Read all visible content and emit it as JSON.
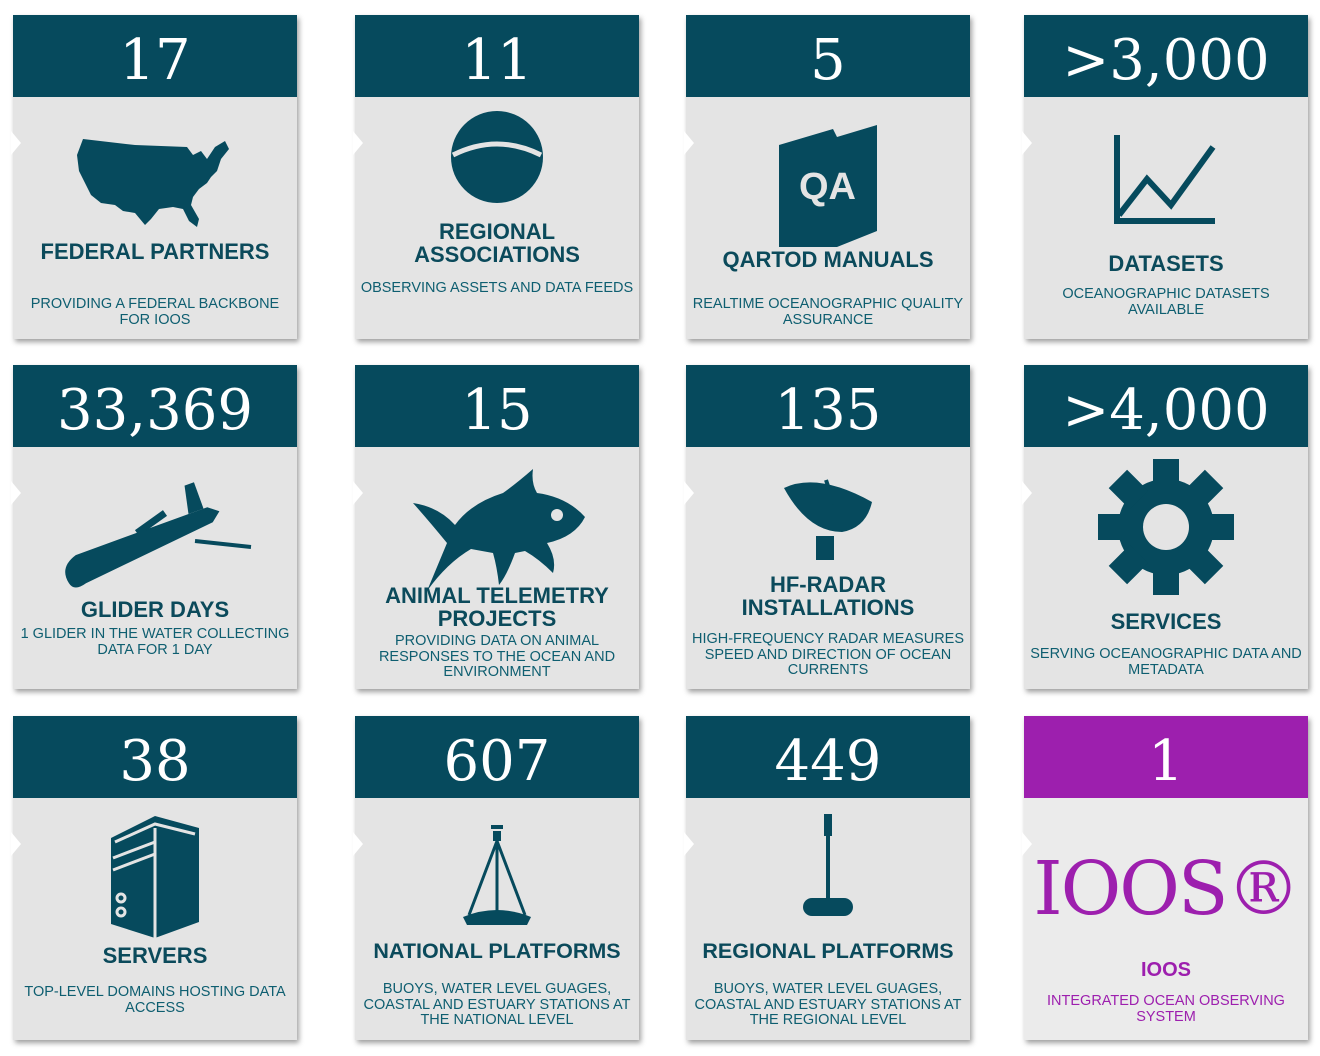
{
  "cards": [
    {
      "number": "17",
      "title": "FEDERAL PARTNERS",
      "description": "PROVIDING A FEDERAL BACKBONE FOR IOOS",
      "icon": "usa-map-icon"
    },
    {
      "number": "11",
      "title": "REGIONAL ASSOCIATIONS",
      "description": "OBSERVING ASSETS AND DATA FEEDS",
      "icon": "sphere-icon"
    },
    {
      "number": "5",
      "title": "QARTOD MANUALS",
      "description": "REALTIME OCEANOGRAPHIC QUALITY ASSURANCE",
      "icon": "qa-manual-icon",
      "icon_text": "QA"
    },
    {
      "number": ">3,000",
      "title": "DATASETS",
      "description": "OCEANOGRAPHIC DATASETS AVAILABLE",
      "icon": "line-chart-icon"
    },
    {
      "number": "33,369",
      "title": "GLIDER DAYS",
      "description": "1 GLIDER IN THE WATER COLLECTING DATA FOR 1 DAY",
      "icon": "glider-icon"
    },
    {
      "number": "15",
      "title": "ANIMAL TELEMETRY PROJECTS",
      "description": "PROVIDING DATA ON ANIMAL RESPONSES TO THE OCEAN AND ENVIRONMENT",
      "icon": "fish-icon"
    },
    {
      "number": "135",
      "title": "HF-RADAR INSTALLATIONS",
      "description": "HIGH-FREQUENCY RADAR MEASURES SPEED AND DIRECTION OF OCEAN CURRENTS",
      "icon": "radar-dish-icon"
    },
    {
      "number": ">4,000",
      "title": "SERVICES",
      "description": "SERVING OCEANOGRAPHIC DATA AND METADATA",
      "icon": "gear-icon"
    },
    {
      "number": "38",
      "title": "SERVERS",
      "description": "TOP-LEVEL DOMAINS HOSTING DATA ACCESS",
      "icon": "server-icon"
    },
    {
      "number": "607",
      "title": "NATIONAL PLATFORMS",
      "description": "BUOYS, WATER LEVEL GUAGES, COASTAL AND ESTUARY STATIONS AT THE NATIONAL LEVEL",
      "icon": "buoy-platform-icon"
    },
    {
      "number": "449",
      "title": "REGIONAL PLATFORMS",
      "description": "BUOYS, WATER LEVEL GUAGES, COASTAL AND ESTUARY STATIONS AT THE REGIONAL LEVEL",
      "icon": "pole-platform-icon"
    },
    {
      "number": "1",
      "title": "IOOS",
      "description": "INTEGRATED OCEAN OBSERVING SYSTEM",
      "icon": "ioos-logo",
      "logo_text": "IOOS®"
    }
  ],
  "colors": {
    "teal": "#064a5d",
    "purple": "#9d1fae",
    "card": "#e4e4e4"
  }
}
